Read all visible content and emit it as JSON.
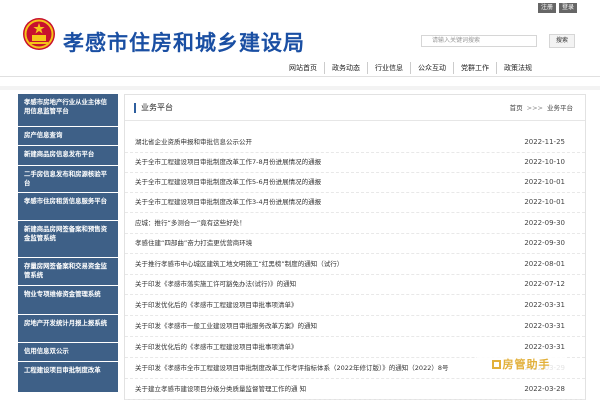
{
  "header": {
    "site_title": "孝感市住房和城乡建设局",
    "top_links": [
      "注册",
      "登录"
    ],
    "search_placeholder": "请输入关键词搜索",
    "search_button": "搜索",
    "emblem_icon": "national-emblem-icon",
    "title_color": "#1a4fa3"
  },
  "nav": {
    "items": [
      "网站首页",
      "政务动态",
      "行业信息",
      "公众互动",
      "党群工作",
      "政策法规"
    ]
  },
  "sidebar": {
    "accent": "#3e6087",
    "items": [
      "孝感市房地产行业从业主体信用信息监管平台",
      "房产信息查询",
      "新建商品房信息发布平台",
      "二手房信息发布和房源核验平台",
      "孝感市住房租赁信息服务平台",
      "新建商品房网签备案和预售资金监管系统",
      "存量房网签备案和交易资金监管系统",
      "物业专项维修资金管理系统",
      "房地产开发统计月报上报系统",
      "信用信息双公示",
      "工程建设项目审批制度改革"
    ]
  },
  "panel": {
    "title": "业务平台",
    "breadcrumb_home": "首页",
    "breadcrumb_sep": ">>>",
    "breadcrumb_current": "业务平台"
  },
  "articles": [
    {
      "title": "湖北省企业资质申报和审批信息公示公开",
      "date": "2022-11-25"
    },
    {
      "title": "关于全市工程建设项目审批制度改革工作7-8月份进展情况的通报",
      "date": "2022-10-10"
    },
    {
      "title": "关于全市工程建设项目审批制度改革工作5-6月份进展情况的通报",
      "date": "2022-10-01"
    },
    {
      "title": "关于全市工程建设项目审批制度改革工作3-4月份进展情况的通报",
      "date": "2022-10-01"
    },
    {
      "title": "应城：推行“多测合一”竟有这些好处！",
      "date": "2022-09-30"
    },
    {
      "title": "孝感住建“四部曲”奋力打造更优营商环境",
      "date": "2022-09-30"
    },
    {
      "title": "关于推行孝感市中心城区建筑工地文明施工“红黑榜”制度的通知（试行）",
      "date": "2022-08-01"
    },
    {
      "title": "关于印发《孝感市落实施工许可豁免办法(试行)》的通知",
      "date": "2022-07-12"
    },
    {
      "title": "关于印发优化后的《孝感市工程建设项目审批事项清单》",
      "date": "2022-03-31"
    },
    {
      "title": "关于印发《孝感市一般工业建设项目审批服务改革方案》的通知",
      "date": "2022-03-31"
    },
    {
      "title": "关于印发优化后的《孝感市工程建设项目审批事项清单》",
      "date": "2022-03-31"
    },
    {
      "title": "关于印发《孝感市全市工程建设项目审批制度改革工作考评指标体系（2022年修订版）》的通知（2022）8号",
      "date": "2022-03-29"
    },
    {
      "title": "关于建立孝感市建设项目分级分类质量监督管理工作的通 知",
      "date": "2022-03-28"
    }
  ],
  "watermark": {
    "text": "房管助手",
    "icon": "house-manager-logo-icon",
    "color": "#e2b03a"
  }
}
